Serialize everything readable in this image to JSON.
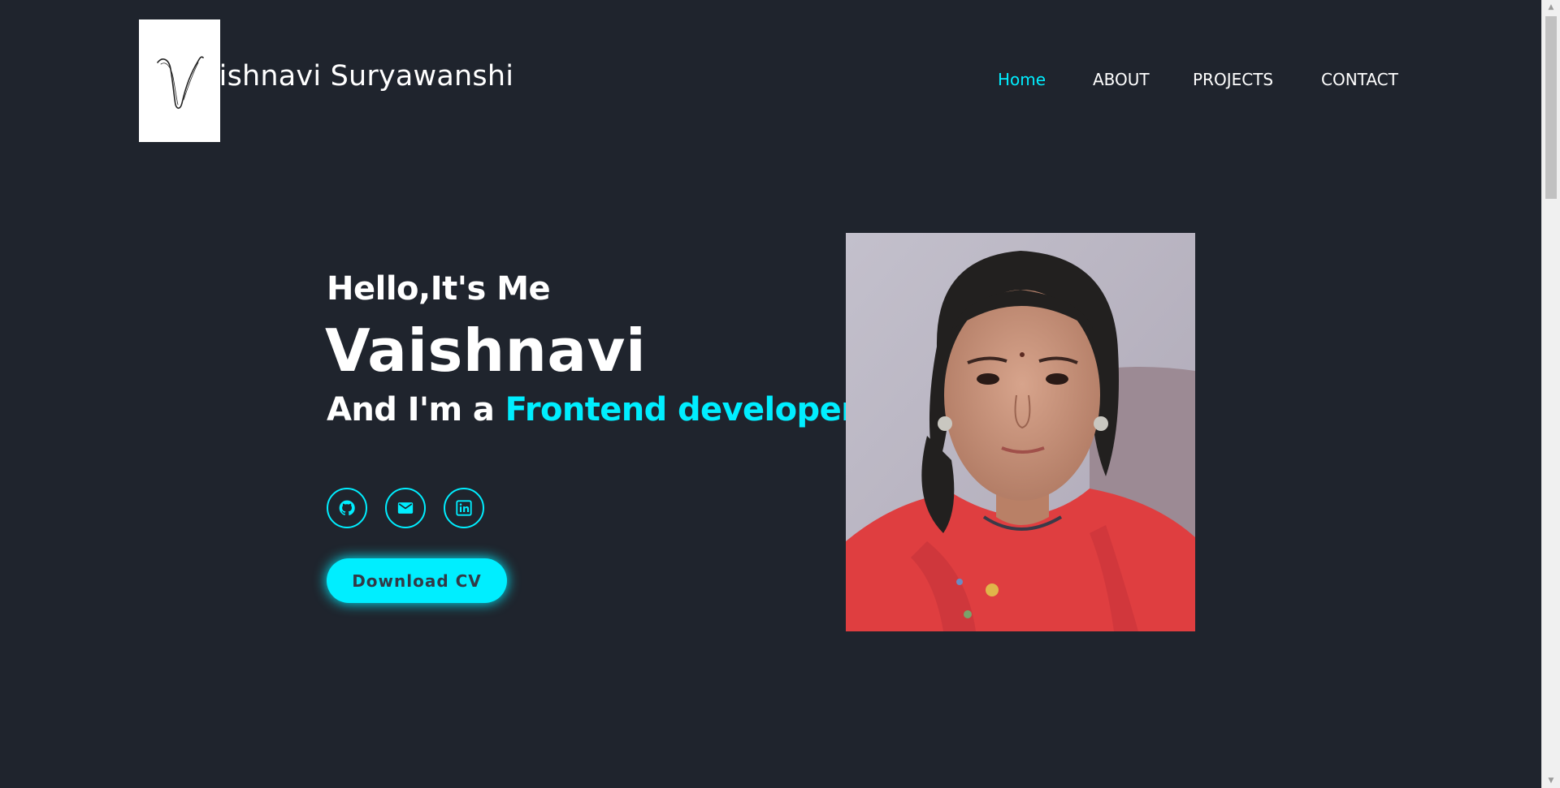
{
  "header": {
    "brand_name": "aishnavi Suryawanshi",
    "logo_letter": "V",
    "nav": [
      {
        "label": "Home",
        "active": true
      },
      {
        "label": "ABOUT",
        "active": false
      },
      {
        "label": "PROJECTS",
        "active": false
      },
      {
        "label": "CONTACT",
        "active": false
      }
    ]
  },
  "hero": {
    "greeting": "Hello,It's Me",
    "name": "Vaishnavi",
    "role_prefix": "And I'm a ",
    "role": "Frontend developer",
    "caret": "|",
    "cv_button_label": "Download CV"
  },
  "social": [
    {
      "icon": "github-icon"
    },
    {
      "icon": "mail-icon"
    },
    {
      "icon": "linkedin-icon"
    }
  ],
  "theme": {
    "background": "#1f242d",
    "accent": "#00eeff",
    "button_text": "#323946",
    "text": "#ffffff"
  }
}
